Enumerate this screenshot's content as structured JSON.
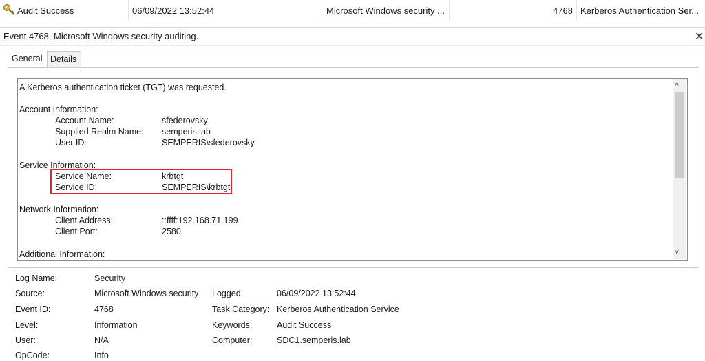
{
  "list_row": {
    "level": "Audit Success",
    "date_time": "06/09/2022 13:52:44",
    "source": "Microsoft Windows security ...",
    "event_id": "4768",
    "task_category": "Kerberos Authentication Ser..."
  },
  "header": {
    "title": "Event 4768, Microsoft Windows security auditing."
  },
  "tabs": [
    "General",
    "Details"
  ],
  "message": {
    "intro": "A Kerberos authentication ticket (TGT) was requested.",
    "account_section": "Account Information:",
    "account": [
      {
        "label": "Account Name:",
        "value": "sfederovsky"
      },
      {
        "label": "Supplied Realm Name:",
        "value": "semperis.lab"
      },
      {
        "label": "User ID:",
        "value": "SEMPERIS\\sfederovsky"
      }
    ],
    "service_section": "Service Information:",
    "service": [
      {
        "label": "Service Name:",
        "value": "krbtgt"
      },
      {
        "label": "Service ID:",
        "value": "SEMPERIS\\krbtgt"
      }
    ],
    "network_section": "Network Information:",
    "network": [
      {
        "label": "Client Address:",
        "value": "::ffff:192.168.71.199"
      },
      {
        "label": "Client Port:",
        "value": "2580"
      }
    ],
    "additional_section": "Additional Information:"
  },
  "details": {
    "log_name_label": "Log Name:",
    "log_name": "Security",
    "source_label": "Source:",
    "source": "Microsoft Windows security",
    "logged_label": "Logged:",
    "logged": "06/09/2022 13:52:44",
    "event_id_label": "Event ID:",
    "event_id": "4768",
    "task_category_label": "Task Category:",
    "task_category": "Kerberos Authentication Service",
    "level_label": "Level:",
    "level": "Information",
    "keywords_label": "Keywords:",
    "keywords": "Audit Success",
    "user_label": "User:",
    "user": "N/A",
    "computer_label": "Computer:",
    "computer": "SDC1.semperis.lab",
    "opcode_label": "OpCode:",
    "opcode": "Info"
  },
  "colors": {
    "highlight": "#e0262b"
  },
  "icons": {
    "row_icon": "key-icon",
    "close": "close-icon"
  }
}
